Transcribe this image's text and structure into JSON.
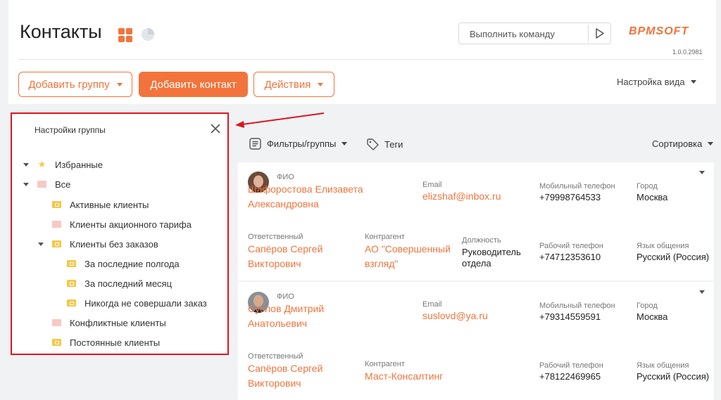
{
  "header": {
    "title": "Контакты",
    "command_placeholder": "Выполнить команду",
    "logo": "BPMSOFT",
    "version": "1.0.0.2981"
  },
  "actions": {
    "add_group": "Добавить группу",
    "add_contact": "Добавить контакт",
    "actions": "Действия",
    "view_settings": "Настройка вида"
  },
  "group_panel": {
    "title": "Настройки группы",
    "items": [
      {
        "label": "Избранные",
        "icon": "star-icon"
      },
      {
        "label": "Все",
        "icon": "folder-icon"
      },
      {
        "label": "Активные клиенты",
        "icon": "dynamic-folder-icon"
      },
      {
        "label": "Клиенты акционного тарифа",
        "icon": "folder-icon"
      },
      {
        "label": "Клиенты без заказов",
        "icon": "dynamic-folder-icon"
      },
      {
        "label": "За последние полгода",
        "icon": "dynamic-folder-icon"
      },
      {
        "label": "За последний месяц",
        "icon": "dynamic-folder-icon"
      },
      {
        "label": "Никогда не совершали заказ",
        "icon": "dynamic-folder-icon"
      },
      {
        "label": "Конфликтные клиенты",
        "icon": "folder-icon"
      },
      {
        "label": "Постоянные клиенты",
        "icon": "dynamic-folder-icon"
      }
    ]
  },
  "toolbar": {
    "filters": "Фильтры/группы",
    "tags": "Теги",
    "sort": "Сортировка"
  },
  "labels": {
    "fio": "ФИО",
    "email": "Email",
    "mobile": "Мобильный телефон",
    "city": "Город",
    "owner": "Ответственный",
    "account": "Контрагент",
    "job": "Должность",
    "work_phone": "Рабочий телефон",
    "language": "Язык общения"
  },
  "contacts": [
    {
      "name_line1": "Шафоростова Елизавета",
      "name_line2": "Александровна",
      "email": "elizshaf@inbox.ru",
      "mobile": "+79998764533",
      "city": "Москва",
      "owner_line1": "Сапёров Сергей",
      "owner_line2": "Викторович",
      "account_line1": "АО \"Совершенный",
      "account_line2": "взгляд\"",
      "job_line1": "Руководитель",
      "job_line2": "отдела",
      "work_phone": "+74712353610",
      "language": "Русский (Россия)"
    },
    {
      "name_line1": "Суслов Дмитрий",
      "name_line2": "Анатольевич",
      "email": "suslovd@ya.ru",
      "mobile": "+79314559591",
      "city": "Москва",
      "owner_line1": "Сапёров Сергей",
      "owner_line2": "Викторович",
      "account_line1": "Маст-Консалтинг",
      "work_phone": "+78122469965",
      "language": "Русский (Россия)"
    }
  ],
  "colors": {
    "accent": "#f2743c",
    "highlight_border": "#e0141e"
  }
}
